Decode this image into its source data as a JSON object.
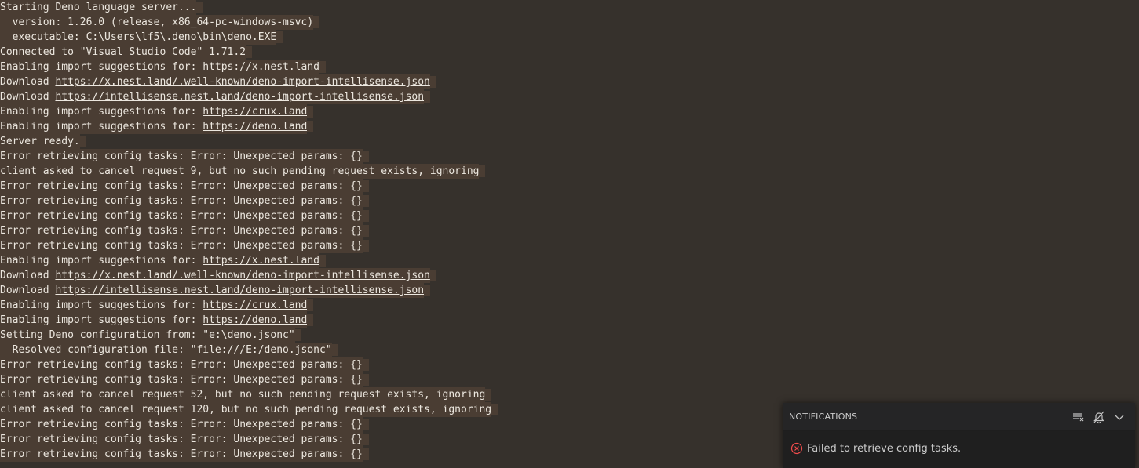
{
  "output": {
    "lines": [
      [
        {
          "t": "Starting Deno language server..."
        }
      ],
      [
        {
          "t": "  version: 1.26.0 (release, x86_64-pc-windows-msvc)"
        }
      ],
      [
        {
          "t": "  executable: C:\\Users\\lf5\\.deno\\bin\\deno.EXE"
        }
      ],
      [
        {
          "t": "Connected to \"Visual Studio Code\" 1.71.2"
        }
      ],
      [
        {
          "t": "Enabling import suggestions for: "
        },
        {
          "t": "https://x.nest.land",
          "link": true
        }
      ],
      [
        {
          "t": "Download "
        },
        {
          "t": "https://x.nest.land/.well-known/deno-import-intellisense.json",
          "link": true
        }
      ],
      [
        {
          "t": "Download "
        },
        {
          "t": "https://intellisense.nest.land/deno-import-intellisense.json",
          "link": true
        }
      ],
      [
        {
          "t": "Enabling import suggestions for: "
        },
        {
          "t": "https://crux.land",
          "link": true
        }
      ],
      [
        {
          "t": "Enabling import suggestions for: "
        },
        {
          "t": "https://deno.land",
          "link": true
        }
      ],
      [
        {
          "t": "Server ready."
        }
      ],
      [
        {
          "t": "Error retrieving config tasks: Error: Unexpected params: {}"
        }
      ],
      [
        {
          "t": "client asked to cancel request 9, but no such pending request exists, ignoring"
        }
      ],
      [
        {
          "t": "Error retrieving config tasks: Error: Unexpected params: {}"
        }
      ],
      [
        {
          "t": "Error retrieving config tasks: Error: Unexpected params: {}"
        }
      ],
      [
        {
          "t": "Error retrieving config tasks: Error: Unexpected params: {}"
        }
      ],
      [
        {
          "t": "Error retrieving config tasks: Error: Unexpected params: {}"
        }
      ],
      [
        {
          "t": "Error retrieving config tasks: Error: Unexpected params: {}"
        }
      ],
      [
        {
          "t": "Enabling import suggestions for: "
        },
        {
          "t": "https://x.nest.land",
          "link": true
        }
      ],
      [
        {
          "t": "Download "
        },
        {
          "t": "https://x.nest.land/.well-known/deno-import-intellisense.json",
          "link": true
        }
      ],
      [
        {
          "t": "Download "
        },
        {
          "t": "https://intellisense.nest.land/deno-import-intellisense.json",
          "link": true
        }
      ],
      [
        {
          "t": "Enabling import suggestions for: "
        },
        {
          "t": "https://crux.land",
          "link": true
        }
      ],
      [
        {
          "t": "Enabling import suggestions for: "
        },
        {
          "t": "https://deno.land",
          "link": true
        }
      ],
      [
        {
          "t": "Setting Deno configuration from: \"e:\\deno.jsonc\""
        }
      ],
      [
        {
          "t": "  Resolved configuration file: \""
        },
        {
          "t": "file:///E:/deno.jsonc",
          "link": true
        },
        {
          "t": "\""
        }
      ],
      [
        {
          "t": "Error retrieving config tasks: Error: Unexpected params: {}"
        }
      ],
      [
        {
          "t": "Error retrieving config tasks: Error: Unexpected params: {}"
        }
      ],
      [
        {
          "t": "client asked to cancel request 52, but no such pending request exists, ignoring"
        }
      ],
      [
        {
          "t": "client asked to cancel request 120, but no such pending request exists, ignoring"
        }
      ],
      [
        {
          "t": "Error retrieving config tasks: Error: Unexpected params: {}"
        }
      ],
      [
        {
          "t": "Error retrieving config tasks: Error: Unexpected params: {}"
        }
      ],
      [
        {
          "t": "Error retrieving config tasks: Error: Unexpected params: {}"
        }
      ]
    ]
  },
  "notifications": {
    "title": "NOTIFICATIONS",
    "clear_all_icon": "clear-all-icon",
    "do_not_disturb_icon": "bell-slash-icon",
    "collapse_icon": "chevron-down-icon",
    "items": [
      {
        "icon": "error-icon",
        "message": "Failed to retrieve config tasks."
      }
    ]
  },
  "colors": {
    "background": "#36312c",
    "highlight": "#4a3d33",
    "text": "#ece7df",
    "error": "#f14c4c"
  }
}
